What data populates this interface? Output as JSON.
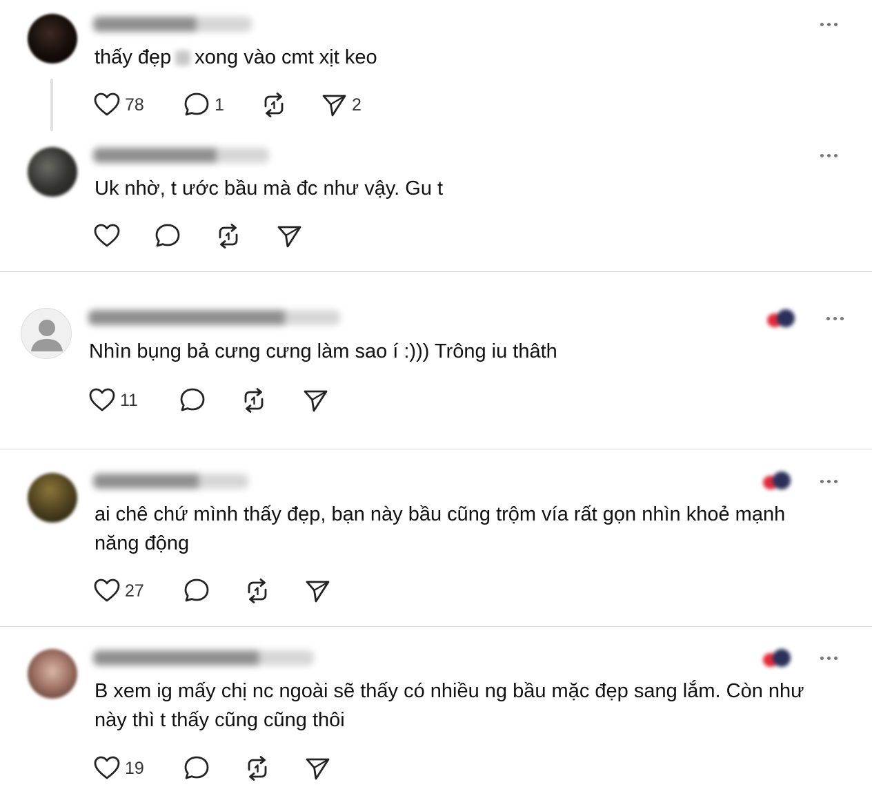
{
  "comments": [
    {
      "text_before": "thấy đẹp",
      "text_after": "xong vào cmt xịt keo",
      "likes": "78",
      "replies": "1",
      "reposts": "",
      "shares": "2"
    },
    {
      "text": "Uk nhờ, t ước bầu mà đc như vậy. Gu t",
      "likes": "",
      "replies": "",
      "reposts": "",
      "shares": ""
    },
    {
      "text": "Nhìn bụng bả cưng cưng làm sao í :))) Trông iu thâth",
      "likes": "11",
      "replies": "",
      "reposts": "",
      "shares": ""
    },
    {
      "text_line1": "ai chê chứ mình thấy đẹp, bạn này bầu cũng trộm vía rất gọn nhìn khoẻ mạnh",
      "text_line2": "năng động",
      "likes": "27",
      "replies": "",
      "reposts": "",
      "shares": ""
    },
    {
      "text_line1": "B xem ig mấy chị nc ngoài sẽ thấy có nhiều ng bầu mặc đẹp sang lắm. Còn như",
      "text_line2": "này thì t thấy cũng cũng thôi",
      "likes": "19",
      "replies": "",
      "reposts": "",
      "shares": ""
    }
  ],
  "icons": {
    "like": "heart-icon",
    "reply": "comment-bubble-icon",
    "repost": "repost-icon",
    "share": "send-icon",
    "more": "more-dots-icon"
  },
  "colors": {
    "text": "#111111",
    "muted": "#777777",
    "divider": "#d9d9d9",
    "icon": "#222222"
  }
}
